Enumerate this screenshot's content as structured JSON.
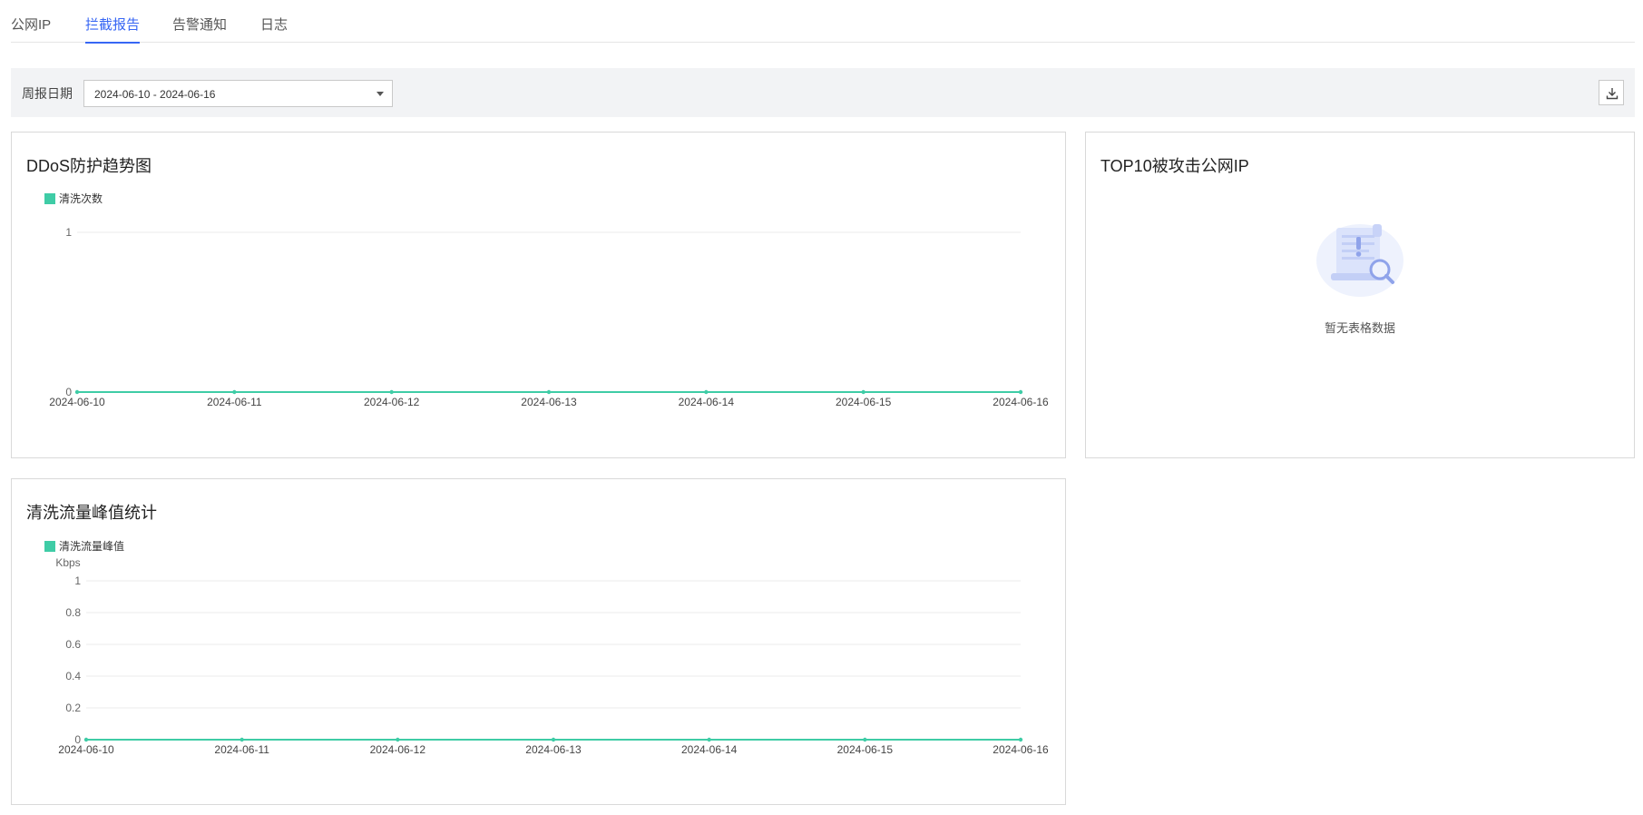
{
  "tabs": [
    {
      "label": "公网IP",
      "active": false
    },
    {
      "label": "拦截报告",
      "active": true
    },
    {
      "label": "告警通知",
      "active": false
    },
    {
      "label": "日志",
      "active": false
    }
  ],
  "filter": {
    "label": "周报日期",
    "date_range": "2024-06-10 - 2024-06-16"
  },
  "colors": {
    "accent": "#3766f4",
    "series": "#3fcca6"
  },
  "cards": {
    "ddos": {
      "title": "DDoS防护趋势图",
      "legend": "清洗次数"
    },
    "top10": {
      "title": "TOP10被攻击公网IP",
      "empty_text": "暂无表格数据",
      "empty_icon": "no-data-illustration"
    },
    "peak": {
      "title": "清洗流量峰值统计",
      "legend": "清洗流量峰值",
      "unit": "Kbps"
    }
  },
  "chart_data": [
    {
      "type": "line",
      "x": [
        "2024-06-10",
        "2024-06-11",
        "2024-06-12",
        "2024-06-13",
        "2024-06-14",
        "2024-06-15",
        "2024-06-16"
      ],
      "series": [
        {
          "name": "清洗次数",
          "values": [
            0,
            0,
            0,
            0,
            0,
            0,
            0
          ]
        }
      ],
      "yticks": [
        "0",
        "1"
      ],
      "ylim": [
        0,
        1
      ],
      "grid": true,
      "legend_position": "top-left"
    },
    {
      "type": "line",
      "x": [
        "2024-06-10",
        "2024-06-11",
        "2024-06-12",
        "2024-06-13",
        "2024-06-14",
        "2024-06-15",
        "2024-06-16"
      ],
      "series": [
        {
          "name": "清洗流量峰值",
          "values": [
            0,
            0,
            0,
            0,
            0,
            0,
            0
          ]
        }
      ],
      "yticks": [
        "0",
        "0.2",
        "0.4",
        "0.6",
        "0.8",
        "1"
      ],
      "ylim": [
        0,
        1
      ],
      "ylabel": "Kbps",
      "grid": true,
      "legend_position": "top-left"
    }
  ]
}
